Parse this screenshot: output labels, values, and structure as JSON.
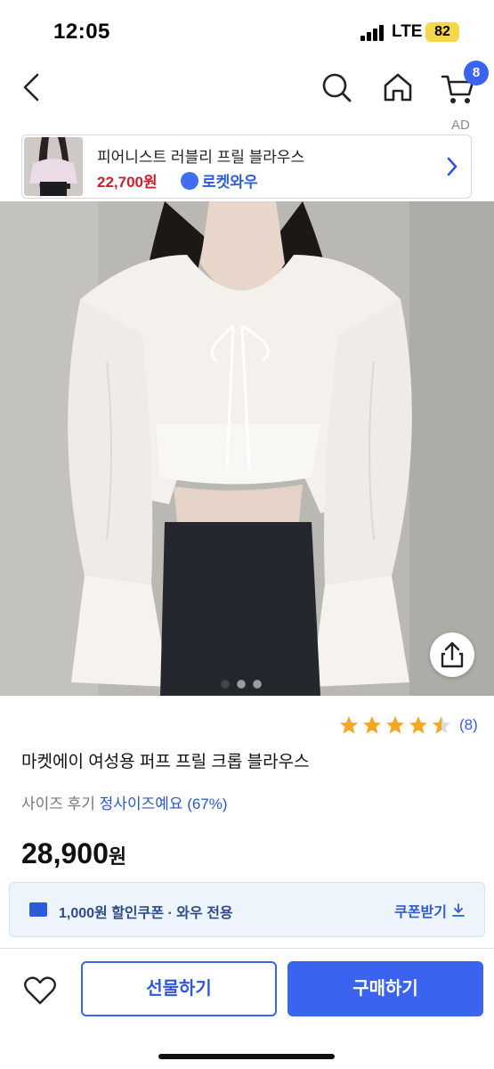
{
  "status_bar": {
    "time": "12:05",
    "network": "LTE",
    "battery": "82"
  },
  "nav": {
    "cart_count": "8",
    "ad_label": "AD"
  },
  "ad_banner": {
    "title": "피어니스트 러블리 프릴 블라우스",
    "price": "22,700원",
    "rocket": "로켓와우"
  },
  "product": {
    "rating_count": "(8)",
    "rating_value": 4.5,
    "title": "마켓에이 여성용 퍼프 프릴 크롭 블라우스",
    "size_review_label": "사이즈 후기",
    "size_review_value": "정사이즈예요 (67%)",
    "price_number": "28,900",
    "price_unit": "원",
    "image_page": 1,
    "image_total": 3
  },
  "coupon": {
    "text": "1,000원 할인쿠폰 · 와우 전용",
    "button": "쿠폰받기"
  },
  "bottom_bar": {
    "gift_label": "선물하기",
    "buy_label": "구매하기"
  },
  "colors": {
    "accent": "#3a63f0",
    "price_red": "#c8202f",
    "star": "#f5a623",
    "battery": "#f4d74b"
  }
}
